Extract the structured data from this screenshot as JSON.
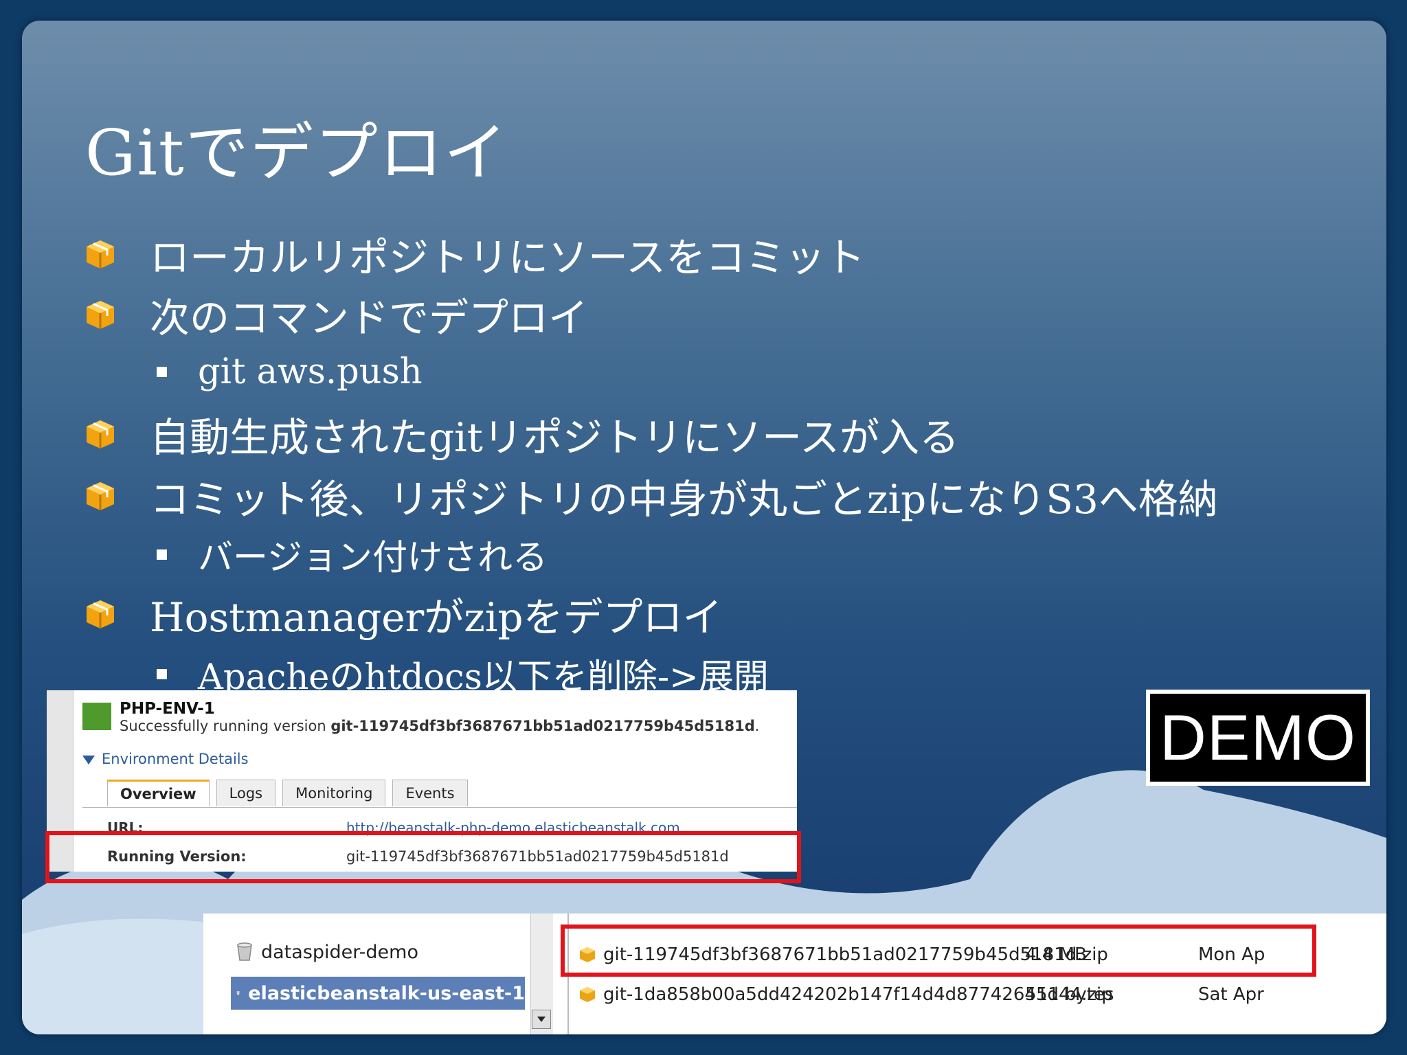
{
  "title": "Gitでデプロイ",
  "bullets": [
    "ローカルリポジトリにソースをコミット",
    "次のコマンドでデプロイ",
    "自動生成されたgitリポジトリにソースが入る",
    "コミット後、リポジトリの中身が丸ごとzipになりS3へ格納",
    "Hostmanagerがzipをデプロイ"
  ],
  "sub_bullets": [
    "git aws.push",
    "バージョン付けされる",
    "Apacheのhtdocs以下を削除->展開"
  ],
  "demo_label": "DEMO",
  "beanstalk": {
    "env_name": "PHP-ENV-1",
    "status_prefix": "Successfully running version ",
    "status_version": "git-119745df3bf3687671bb51ad0217759b45d5181d",
    "status_suffix": ".",
    "details_label": "Environment Details",
    "tabs": [
      "Overview",
      "Logs",
      "Monitoring",
      "Events"
    ],
    "url_label": "URL:",
    "url_value": "http://beanstalk-php-demo.elasticbeanstalk.com",
    "running_version_label": "Running Version:",
    "running_version_value": "git-119745df3bf3687671bb51ad0217759b45d5181d"
  },
  "s3": {
    "buckets": [
      "dataspider-demo",
      "elasticbeanstalk-us-east-1"
    ],
    "files": [
      {
        "name": "git-119745df3bf3687671bb51ad0217759b45d5181d.zip",
        "size": "4.4 MB",
        "date": "Mon Ap"
      },
      {
        "name": "git-1da858b00a5dd424202b147f14d4d87742645d44.zip",
        "size": "511 bytes",
        "date": "Sat Apr"
      }
    ]
  },
  "colors": {
    "highlight": "#e1141b",
    "bullet_icon": "#f2a30f",
    "env_status": "#4e9a2c"
  },
  "icons": {
    "bullet": "package-icon",
    "bucket": "bucket-icon",
    "file": "package-icon"
  }
}
